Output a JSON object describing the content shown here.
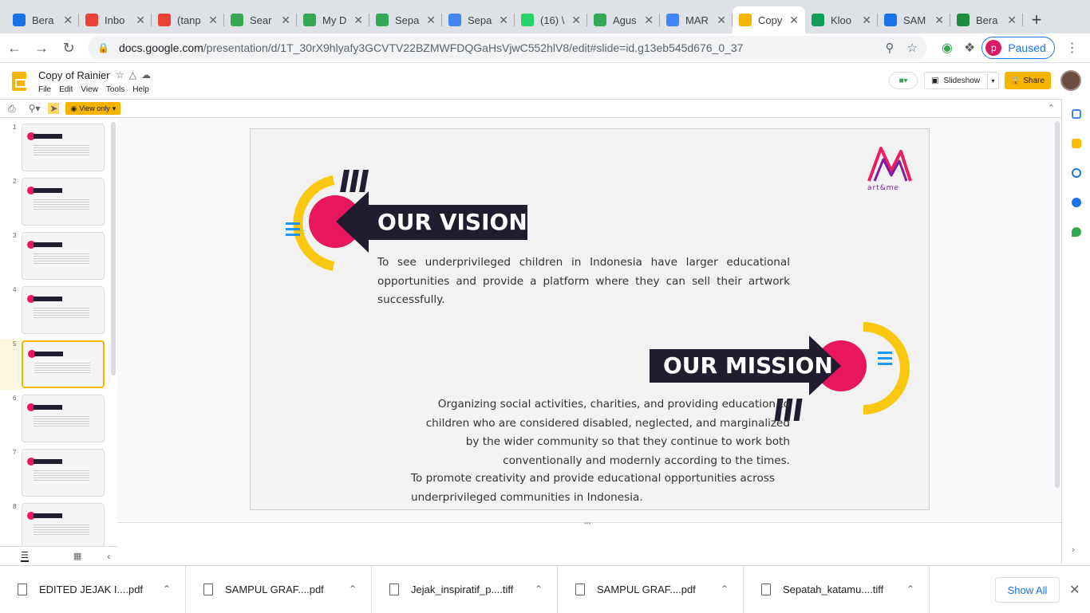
{
  "tabs": [
    {
      "label": "Bera",
      "icon": "c-icon",
      "color": "#1a73e8"
    },
    {
      "label": "Inbo",
      "icon": "gmail-icon",
      "color": "#ea4335"
    },
    {
      "label": "(tanp",
      "icon": "gmail-icon",
      "color": "#ea4335"
    },
    {
      "label": "Sear",
      "icon": "drive-icon",
      "color": "#34a853"
    },
    {
      "label": "My D",
      "icon": "drive-icon",
      "color": "#34a853"
    },
    {
      "label": "Sepa",
      "icon": "drive-icon",
      "color": "#34a853"
    },
    {
      "label": "Sepa",
      "icon": "docs-icon",
      "color": "#4285f4"
    },
    {
      "label": "(16) \\",
      "icon": "whatsapp-icon",
      "color": "#25d366"
    },
    {
      "label": "Agus",
      "icon": "drive-icon",
      "color": "#34a853"
    },
    {
      "label": "MAR",
      "icon": "docs-icon",
      "color": "#4285f4"
    },
    {
      "label": "Copy",
      "icon": "slides-icon",
      "color": "#f4b400",
      "active": true
    },
    {
      "label": "Kloo",
      "icon": "sheets-icon",
      "color": "#0f9d58"
    },
    {
      "label": "SAM",
      "icon": "c-icon",
      "color": "#1a73e8"
    },
    {
      "label": "Bera",
      "icon": "star-icon",
      "color": "#1e8e3e"
    }
  ],
  "newtab": "+",
  "address": {
    "host": "docs.google.com",
    "path": "/presentation/d/1T_30rX9hlyafy3GCVTV22BZMWFDQGaHsVjwC552hlV8/edit#slide=id.g13eb545d676_0_37",
    "profile_initial": "p",
    "profile_status": "Paused"
  },
  "doc": {
    "title": "Copy of Rainier",
    "menu": [
      "File",
      "Edit",
      "View",
      "Tools",
      "Help"
    ],
    "slideshow_label": "Slideshow",
    "share_label": "Share",
    "view_only_label": "View only"
  },
  "thumbnails": [
    {
      "num": "1"
    },
    {
      "num": "2"
    },
    {
      "num": "3"
    },
    {
      "num": "4"
    },
    {
      "num": "5",
      "selected": true
    },
    {
      "num": "6"
    },
    {
      "num": "7"
    },
    {
      "num": "8"
    }
  ],
  "slide": {
    "vision_title": "OUR VISION",
    "vision_text": "To see underprivileged children in Indonesia have larger educational opportunities and provide a platform where they can sell their artwork successfully.",
    "mission_title": "OUR MISSION",
    "mission_text": "Organizing social activities, charities, and providing education to children who are considered disabled, neglected, and marginalized by the wider community so that they continue to work both conventionally and modernly according to the times.",
    "mission_text2": "To promote creativity and provide educational opportunities across underprivileged communities in Indonesia.",
    "logo_text": "art&me"
  },
  "downloads": [
    {
      "name": "EDITED JEJAK I....pdf"
    },
    {
      "name": "SAMPUL GRAF....pdf"
    },
    {
      "name": "Jejak_inspiratif_p....tiff"
    },
    {
      "name": "SAMPUL GRAF....pdf"
    },
    {
      "name": "Sepatah_katamu....tiff"
    }
  ],
  "show_all": "Show All",
  "colors": {
    "accent": "#f4b400",
    "pink": "#e91e63",
    "navy": "#1f1d2e",
    "blue": "#1a73e8"
  }
}
